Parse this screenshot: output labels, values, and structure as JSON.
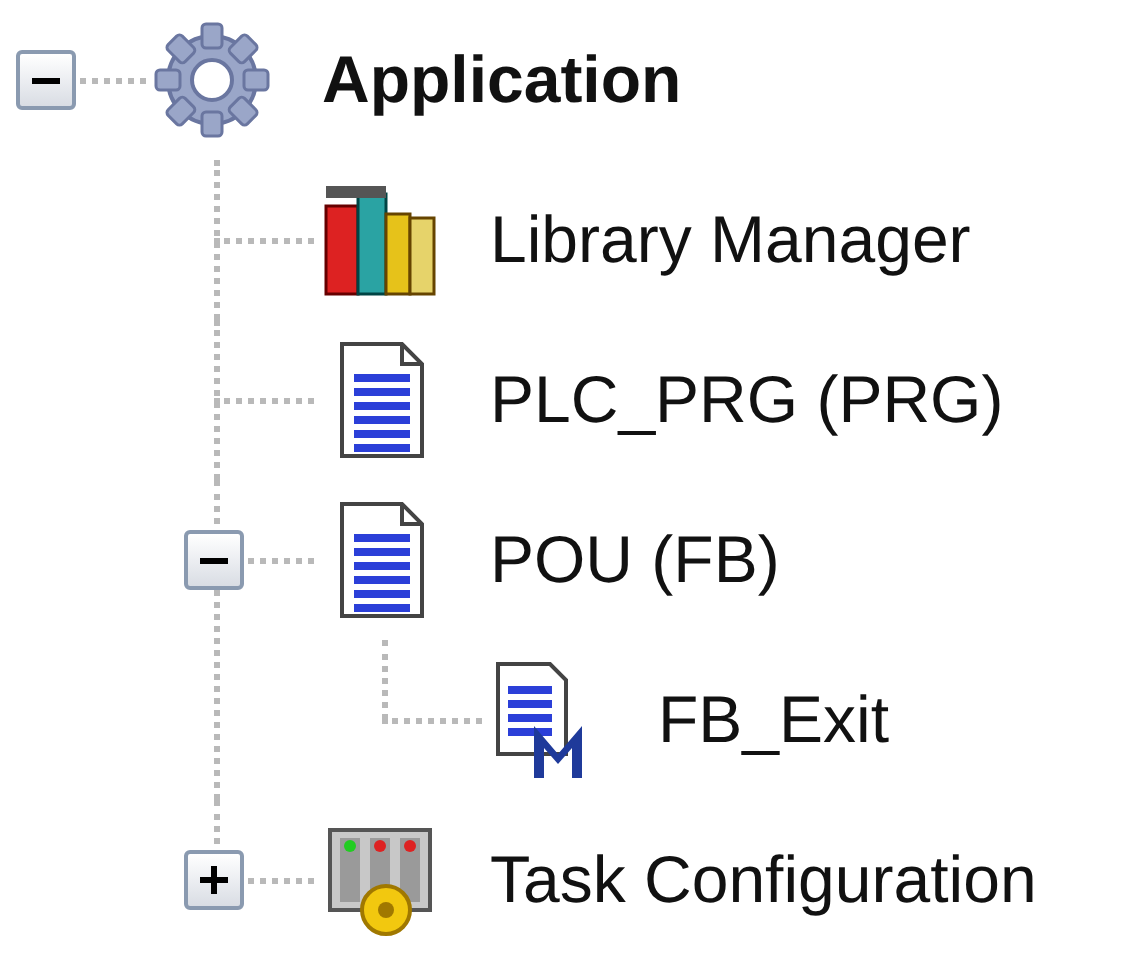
{
  "tree": [
    {
      "label": "Application",
      "kind": "application",
      "expanded": true,
      "children": [
        {
          "label": "Library Manager",
          "kind": "library"
        },
        {
          "label": "PLC_PRG (PRG)",
          "kind": "program"
        },
        {
          "label": "POU (FB)",
          "kind": "program",
          "expanded": true,
          "children": [
            {
              "label": "FB_Exit",
              "kind": "method"
            }
          ]
        },
        {
          "label": "Task Configuration",
          "kind": "tasks",
          "expanded": false
        }
      ]
    }
  ]
}
